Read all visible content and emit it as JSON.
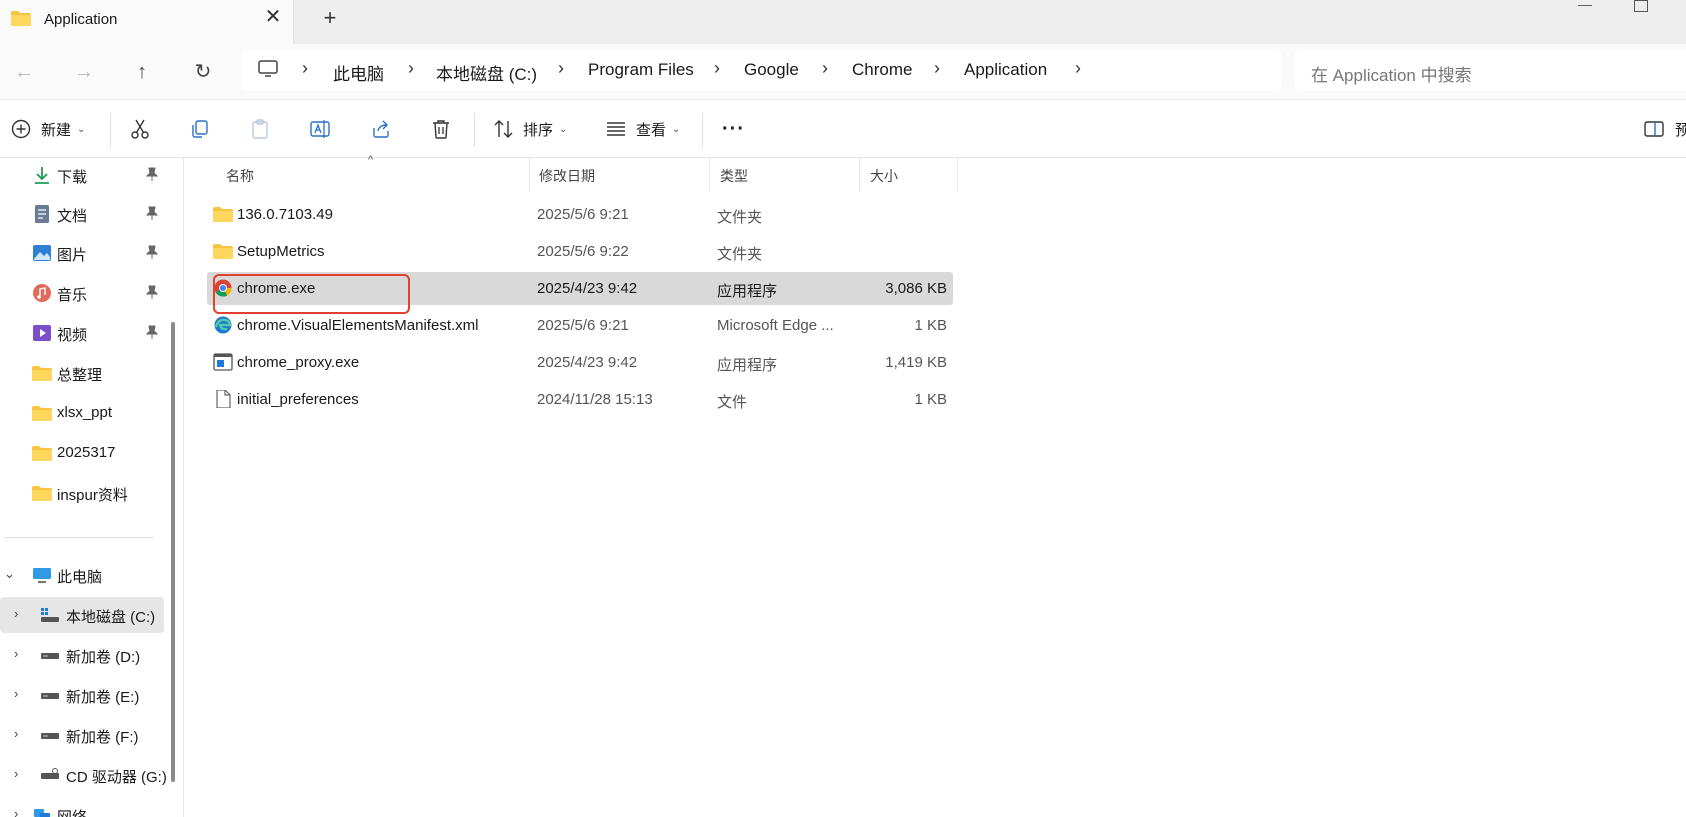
{
  "window": {
    "tab_title": "Application",
    "new_tab_label": "+",
    "close_label": "✕"
  },
  "address_bar": {
    "breadcrumbs": [
      "此电脑",
      "本地磁盘 (C:)",
      "Program Files",
      "Google",
      "Chrome",
      "Application"
    ],
    "separator": "›"
  },
  "search": {
    "placeholder": "在 Application 中搜索"
  },
  "toolbar": {
    "new_label": "新建",
    "sort_label": "排序",
    "view_label": "查看",
    "more_label": "···",
    "preview_label": "预"
  },
  "sidebar": {
    "quick_access": [
      {
        "label": "下载",
        "icon": "download-icon",
        "pinned": true
      },
      {
        "label": "文档",
        "icon": "document-icon",
        "pinned": true
      },
      {
        "label": "图片",
        "icon": "pictures-icon",
        "pinned": true
      },
      {
        "label": "音乐",
        "icon": "music-icon",
        "pinned": true
      },
      {
        "label": "视频",
        "icon": "video-icon",
        "pinned": true
      },
      {
        "label": "总整理",
        "icon": "folder-icon",
        "pinned": false
      },
      {
        "label": "xlsx_ppt",
        "icon": "folder-icon",
        "pinned": false
      },
      {
        "label": "2025317",
        "icon": "folder-icon",
        "pinned": false
      },
      {
        "label": "inspur资料",
        "icon": "folder-icon",
        "pinned": false
      }
    ],
    "tree": [
      {
        "label": "此电脑",
        "icon": "computer-icon",
        "expanded": true
      },
      {
        "label": "本地磁盘 (C:)",
        "icon": "system-drive-icon",
        "selected": true
      },
      {
        "label": "新加卷 (D:)",
        "icon": "drive-icon"
      },
      {
        "label": "新加卷 (E:)",
        "icon": "drive-icon"
      },
      {
        "label": "新加卷 (F:)",
        "icon": "drive-icon"
      },
      {
        "label": "CD 驱动器 (G:)",
        "icon": "cd-drive-icon"
      },
      {
        "label": "网络",
        "icon": "network-icon"
      }
    ]
  },
  "file_list": {
    "columns": [
      "名称",
      "修改日期",
      "类型",
      "大小"
    ],
    "rows": [
      {
        "name": "136.0.7103.49",
        "date": "2025/5/6 9:21",
        "type": "文件夹",
        "size": "",
        "icon": "folder-icon"
      },
      {
        "name": "SetupMetrics",
        "date": "2025/5/6 9:22",
        "type": "文件夹",
        "size": "",
        "icon": "folder-icon"
      },
      {
        "name": "chrome.exe",
        "date": "2025/4/23 9:42",
        "type": "应用程序",
        "size": "3,086 KB",
        "icon": "chrome-icon",
        "selected": true
      },
      {
        "name": "chrome.VisualElementsManifest.xml",
        "date": "2025/5/6 9:21",
        "type": "Microsoft Edge ...",
        "size": "1 KB",
        "icon": "edge-icon"
      },
      {
        "name": "chrome_proxy.exe",
        "date": "2025/4/23 9:42",
        "type": "应用程序",
        "size": "1,419 KB",
        "icon": "app-icon"
      },
      {
        "name": "initial_preferences",
        "date": "2024/11/28 15:13",
        "type": "文件",
        "size": "1 KB",
        "icon": "file-icon"
      }
    ]
  },
  "colors": {
    "folder": "#f4c542",
    "highlight": "#e2412f",
    "selection": "#d9d9d9"
  }
}
